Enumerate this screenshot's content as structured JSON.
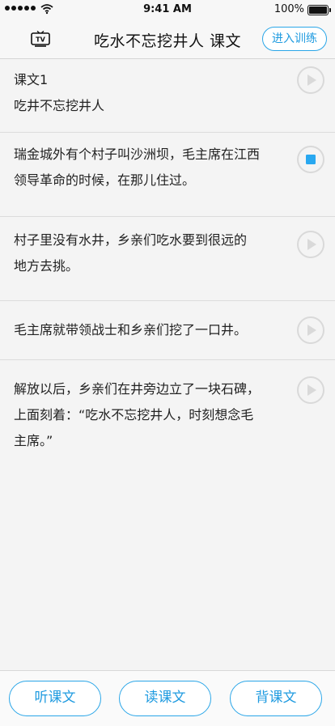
{
  "status_bar": {
    "time": "9:41 AM",
    "battery": "100%"
  },
  "nav": {
    "title": "吃水不忘挖井人 课文",
    "train_label": "进入训练",
    "tv_icon_text": "TV"
  },
  "lesson": {
    "rows": [
      {
        "lines": [
          "课文1",
          "吃井不忘挖井人"
        ],
        "state": "play"
      },
      {
        "lines": [
          "瑞金城外有个村子叫沙洲坝，毛主席在江西",
          "领导革命的时候，在那儿住过。"
        ],
        "state": "stop"
      },
      {
        "lines": [
          "村子里没有水井，乡亲们吃水要到很远的",
          "地方去挑。"
        ],
        "state": "play"
      },
      {
        "lines": [
          "毛主席就带领战士和乡亲们挖了一口井。"
        ],
        "state": "play"
      },
      {
        "lines": [
          "解放以后，乡亲们在井旁边立了一块石碑，",
          "上面刻着：“吃水不忘挖井人，时刻想念毛",
          "主席。”"
        ],
        "state": "play"
      }
    ]
  },
  "bottom": {
    "listen_label": "听课文",
    "read_label": "读课文",
    "recite_label": "背课文"
  },
  "colors": {
    "accent": "#2aa6e8",
    "stop_square": "#29a8f0",
    "play_ring": "#d9d9d9"
  }
}
